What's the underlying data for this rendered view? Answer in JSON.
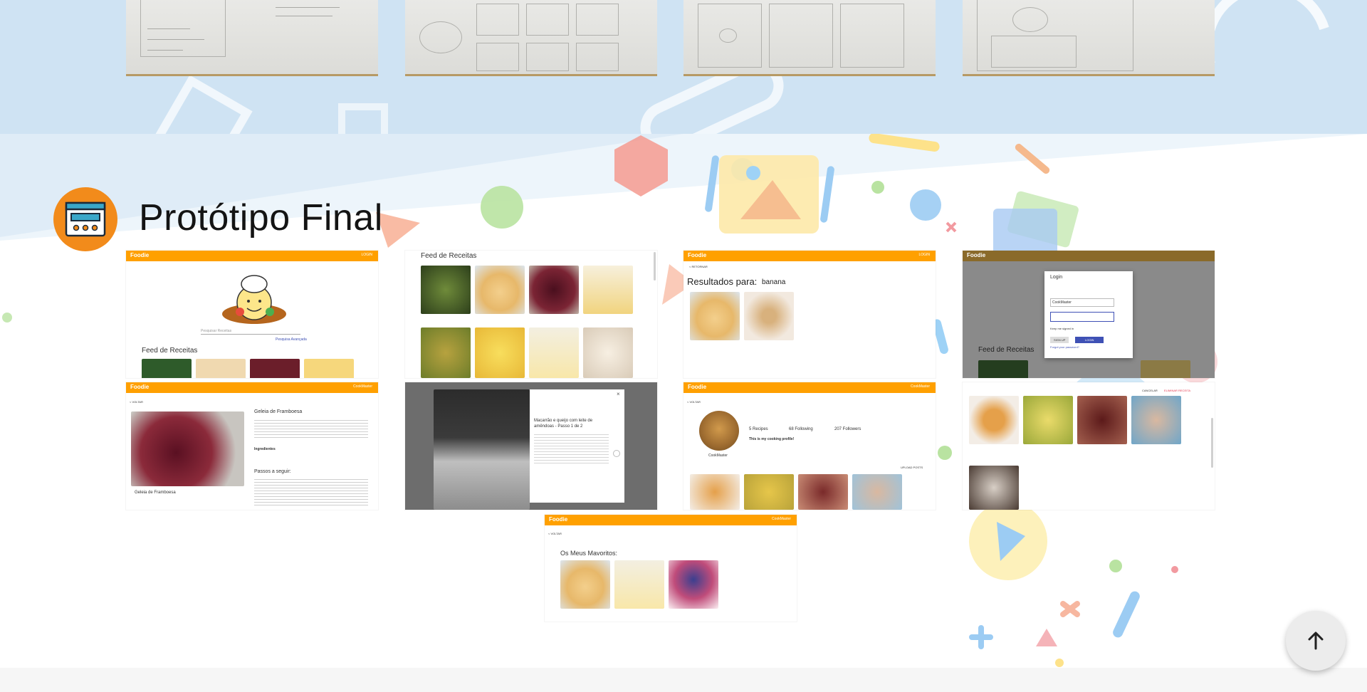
{
  "section": {
    "title": "Protótipo Final",
    "icon": "browser-window-icon"
  },
  "brand": "Foodie",
  "screens": {
    "home": {
      "search_placeholder": "Pesquisar Receitas",
      "advanced_search": "Pesquisa Avançada",
      "feed_title": "Feed de Receitas",
      "login_btn": "LOGIN"
    },
    "feed": {
      "title": "Feed de Receitas"
    },
    "results": {
      "label": "Resultados para:",
      "query": "banana",
      "back": "< RETORNAR"
    },
    "login": {
      "heading": "Login",
      "user_value": "CookMaster",
      "remember": "Keep me signed in",
      "signup": "SIGN UP",
      "login": "LOGIN",
      "forgot": "Forgot your password?",
      "feed_title": "Feed de Receitas"
    },
    "recipe": {
      "back": "< VOLTAR",
      "title": "Geleia de Framboesa",
      "ingredients": "Ingredientes",
      "steps": "Passos a seguir:",
      "caption": "Geleia de Framboesa"
    },
    "step_modal": {
      "title": "Macarrão e queijo com leite de amêndoas - Passo 1 de 2",
      "close": "×"
    },
    "profile": {
      "back": "< VOLTAR",
      "username": "CookMaster",
      "recipes": "5 Recipes",
      "following": "68 Following",
      "followers": "207 Followers",
      "bio": "This is my cooking profile!",
      "upload": "UPLOAD POSTS"
    },
    "my_recipes": {
      "cancel": "CANCELAR",
      "delete": "ELIMINAR RECEITA"
    },
    "favorites": {
      "back": "< VOLTAR",
      "title": "Os Meus Mavoritos:"
    }
  },
  "nav": {
    "add": "+ ADICIONAR",
    "fav": "♡ FAVORITOS",
    "user": "CookMaster"
  },
  "to_top": {
    "icon": "arrow-up-icon"
  },
  "colors": {
    "accent": "#ffa000",
    "icon_bg": "#f28b1b",
    "top_band": "#cfe3f3"
  }
}
